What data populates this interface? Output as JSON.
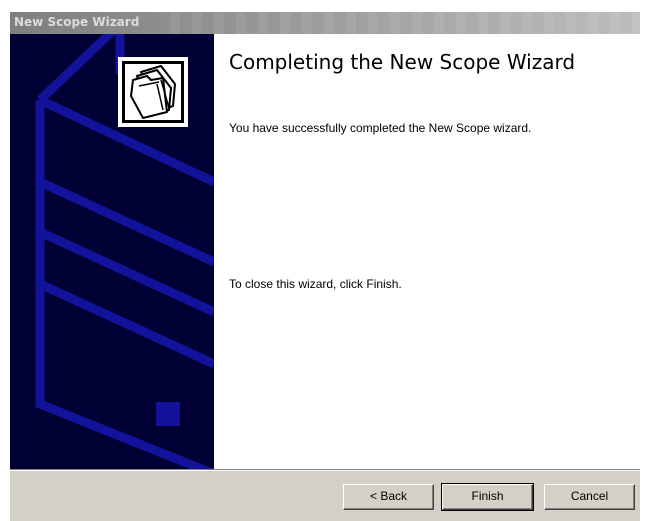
{
  "window": {
    "title": "New Scope Wizard"
  },
  "banner": {
    "icon": "folders-icon",
    "colors": {
      "background": "#000034",
      "outline": "#12129a"
    }
  },
  "content": {
    "heading": "Completing the New Scope Wizard",
    "completed_text": "You have successfully completed the New Scope wizard.",
    "close_text": "To close this wizard, click Finish."
  },
  "buttons": {
    "back_label": "< Back",
    "finish_label": "Finish",
    "cancel_label": "Cancel"
  }
}
